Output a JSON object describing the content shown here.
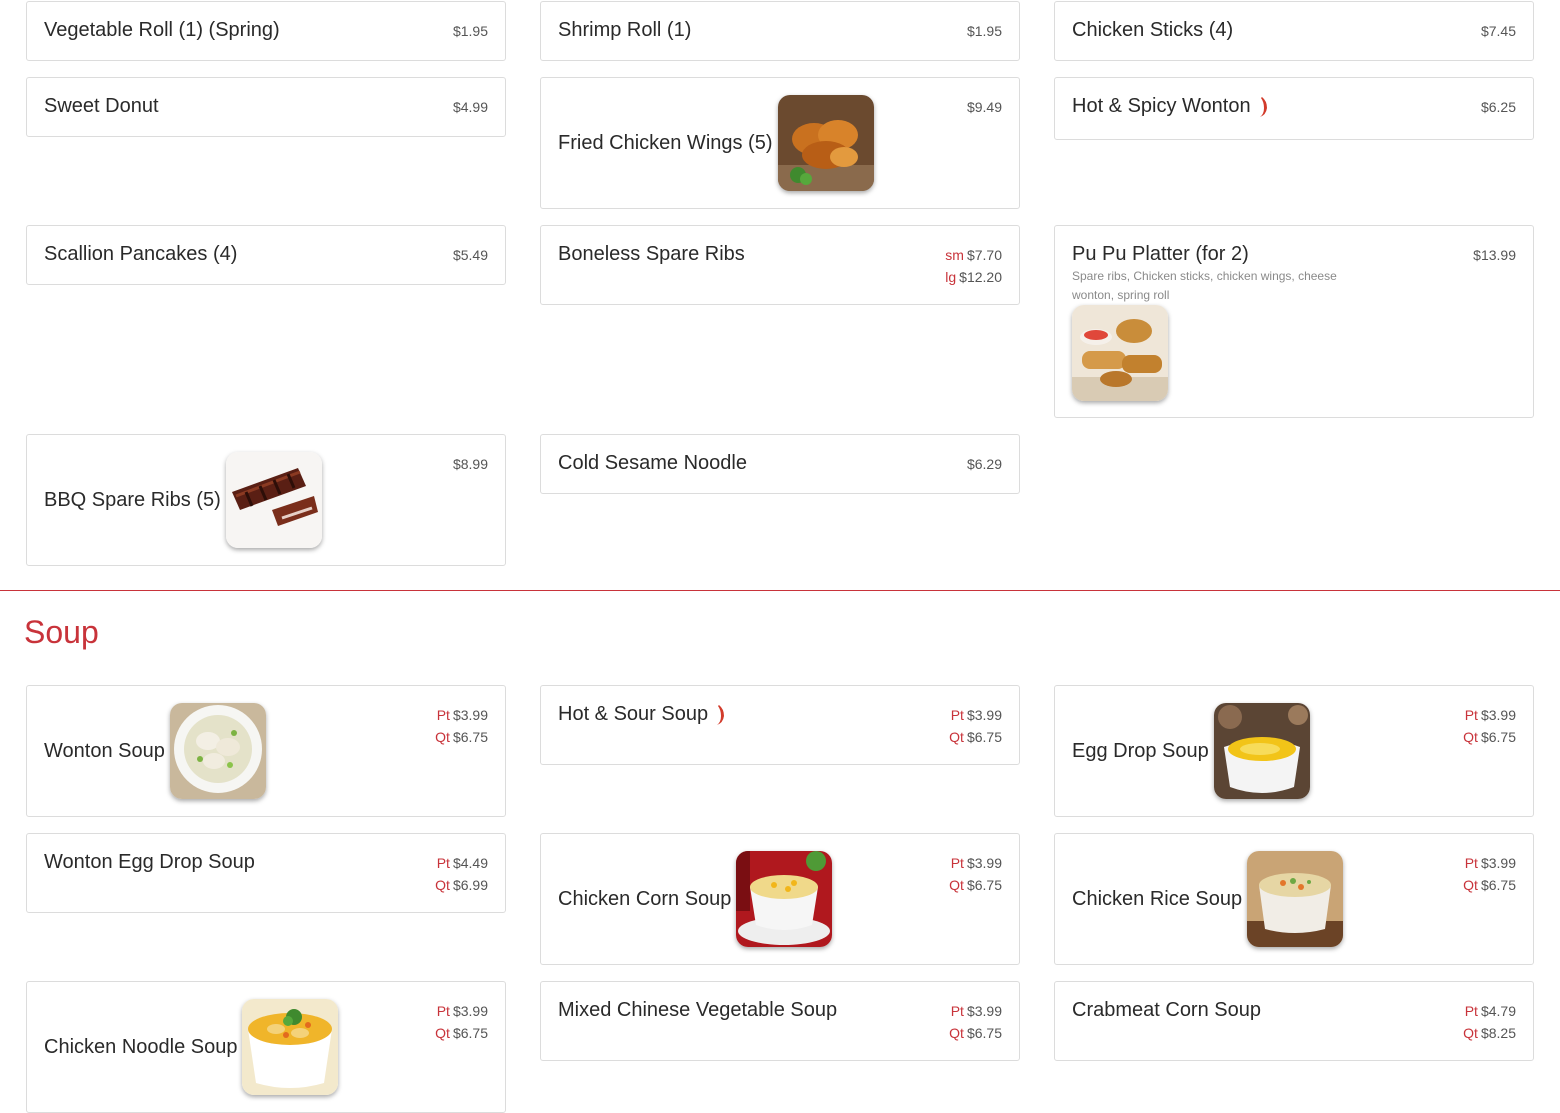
{
  "appetizers": [
    {
      "name": "Vegetable Roll (1) (Spring)",
      "price": "$1.95"
    },
    {
      "name": "Shrimp Roll (1)",
      "price": "$1.95"
    },
    {
      "name": "Chicken Sticks (4)",
      "price": "$7.45"
    },
    {
      "name": "Sweet Donut",
      "price": "$4.99"
    },
    {
      "name": "Fried Chicken Wings (5)",
      "price": "$9.49",
      "image": "fried-chicken-wings-photo"
    },
    {
      "name": "Hot & Spicy Wonton",
      "price": "$6.25",
      "spicy": true
    },
    {
      "name": "Scallion Pancakes (4)",
      "price": "$5.49"
    },
    {
      "name": "Boneless Spare Ribs",
      "prices": [
        {
          "size": "sm",
          "price": "$7.70"
        },
        {
          "size": "lg",
          "price": "$12.20"
        }
      ]
    },
    {
      "name": "Pu Pu Platter (for 2)",
      "price": "$13.99",
      "description": "Spare ribs, Chicken sticks, chicken wings, cheese wonton, spring roll",
      "image": "pu-pu-platter-photo"
    },
    {
      "name": "BBQ Spare Ribs (5)",
      "price": "$8.99",
      "image": "bbq-spare-ribs-photo"
    },
    {
      "name": "Cold Sesame Noodle",
      "price": "$6.29"
    }
  ],
  "soup": {
    "title": "Soup",
    "items": [
      {
        "name": "Wonton Soup",
        "prices": [
          {
            "size": "Pt",
            "price": "$3.99"
          },
          {
            "size": "Qt",
            "price": "$6.75"
          }
        ],
        "image": "wonton-soup-photo"
      },
      {
        "name": "Hot & Sour Soup",
        "spicy": true,
        "prices": [
          {
            "size": "Pt",
            "price": "$3.99"
          },
          {
            "size": "Qt",
            "price": "$6.75"
          }
        ]
      },
      {
        "name": "Egg Drop Soup",
        "prices": [
          {
            "size": "Pt",
            "price": "$3.99"
          },
          {
            "size": "Qt",
            "price": "$6.75"
          }
        ],
        "image": "egg-drop-soup-photo"
      },
      {
        "name": "Wonton Egg Drop Soup",
        "prices": [
          {
            "size": "Pt",
            "price": "$4.49"
          },
          {
            "size": "Qt",
            "price": "$6.99"
          }
        ]
      },
      {
        "name": "Chicken Corn Soup",
        "prices": [
          {
            "size": "Pt",
            "price": "$3.99"
          },
          {
            "size": "Qt",
            "price": "$6.75"
          }
        ],
        "image": "chicken-corn-soup-photo"
      },
      {
        "name": "Chicken Rice Soup",
        "prices": [
          {
            "size": "Pt",
            "price": "$3.99"
          },
          {
            "size": "Qt",
            "price": "$6.75"
          }
        ],
        "image": "chicken-rice-soup-photo"
      },
      {
        "name": "Chicken Noodle Soup",
        "prices": [
          {
            "size": "Pt",
            "price": "$3.99"
          },
          {
            "size": "Qt",
            "price": "$6.75"
          }
        ],
        "image": "chicken-noodle-soup-photo"
      },
      {
        "name": "Mixed Chinese Vegetable Soup",
        "prices": [
          {
            "size": "Pt",
            "price": "$3.99"
          },
          {
            "size": "Qt",
            "price": "$6.75"
          }
        ]
      },
      {
        "name": "Crabmeat Corn Soup",
        "prices": [
          {
            "size": "Pt",
            "price": "$4.79"
          },
          {
            "size": "Qt",
            "price": "$8.25"
          }
        ]
      }
    ]
  },
  "colors": {
    "accent": "#c8333a",
    "border": "#dcdcdc",
    "text": "#2a2a2a",
    "price": "#555555"
  },
  "icons": {
    "spicy": "chili-pepper-icon"
  }
}
